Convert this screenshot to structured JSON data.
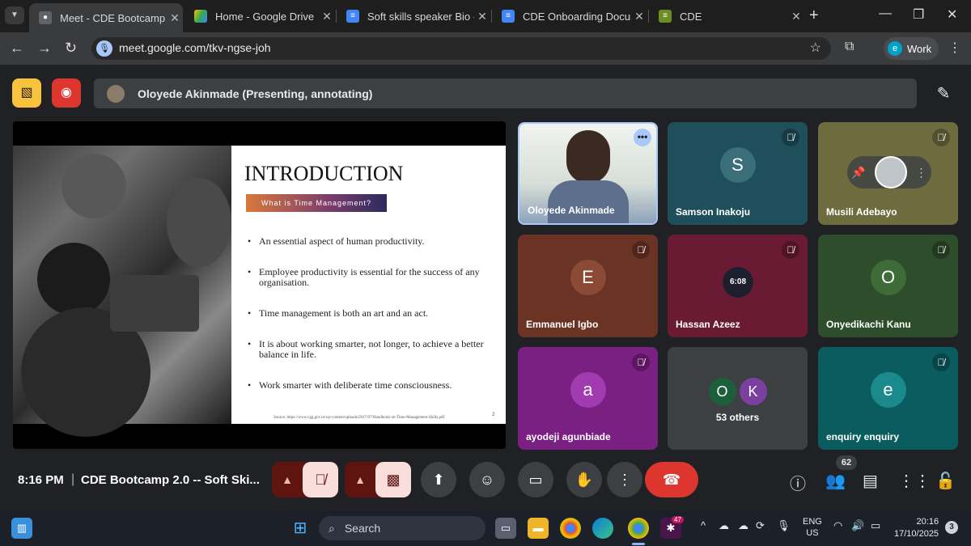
{
  "browser": {
    "tabs": [
      {
        "label": "Meet - CDE Bootcamp",
        "favicon": "meet-icon"
      },
      {
        "label": "Home - Google Drive",
        "favicon": "drive-icon"
      },
      {
        "label": "Soft skills speaker Bio - G",
        "favicon": "docs-icon"
      },
      {
        "label": "CDE Onboarding Docume",
        "favicon": "docs-icon"
      },
      {
        "label": "CDE",
        "favicon": "sheets-icon"
      }
    ],
    "url": "meet.google.com/tkv-ngse-joh",
    "profile_initial": "e",
    "profile_label": "Work"
  },
  "meet": {
    "presenting_banner": "Oloyede Akinmade (Presenting, annotating)",
    "slide": {
      "title": "INTRODUCTION",
      "banner": "What is Time Management?",
      "bullets": [
        "An essential aspect of human productivity.",
        "Employee productivity is essential for the success of any organisation.",
        "Time management is both an art and an act.",
        "It is about working smarter, not longer, to achieve a better balance in life.",
        "Work smarter with deliberate time consciousness."
      ],
      "source": "Source: https://www.cgg.gov.in/wp-content/uploads/2017/07/Handbook-on-Time-Management-Skills.pdf",
      "page": "2"
    },
    "participants": [
      {
        "name": "Oloyede Akinmade",
        "initial": "",
        "color": "#ffffff"
      },
      {
        "name": "Samson Inakoju",
        "initial": "S",
        "color": "#1f4f5a"
      },
      {
        "name": "Musili Adebayo",
        "initial": "",
        "color": "#6e6b3e"
      },
      {
        "name": "Emmanuel Igbo",
        "initial": "E",
        "color": "#6b3324"
      },
      {
        "name": "Hassan Azeez",
        "initial": "",
        "color": "#6a1b33"
      },
      {
        "name": "Onyedikachi Kanu",
        "initial": "O",
        "color": "#2e4d2a"
      },
      {
        "name": "ayodeji agunbiade",
        "initial": "a",
        "color": "#7a2082"
      },
      {
        "name": "53 others",
        "initial": "",
        "color": "#3c4043"
      },
      {
        "name": "enquiry enquiry",
        "initial": "e",
        "color": "#0b5c5e"
      }
    ],
    "others_initials": [
      "O",
      "K"
    ],
    "hassan_avatar_text": "6:08",
    "controls": {
      "time": "8:16 PM",
      "separator": "|",
      "meeting_title": "CDE Bootcamp 2.0 -- Soft Ski...",
      "participant_count": "62"
    }
  },
  "taskbar": {
    "search_placeholder": "Search",
    "lang_line1": "ENG",
    "lang_line2": "US",
    "time": "20:16",
    "date": "17/10/2025",
    "notification_count": "3",
    "chrome_badge": "47"
  },
  "colors": {
    "end_call": "#dc362e",
    "muted_bg": "#f9dedc",
    "speaker_border": "#a8c7fa"
  }
}
